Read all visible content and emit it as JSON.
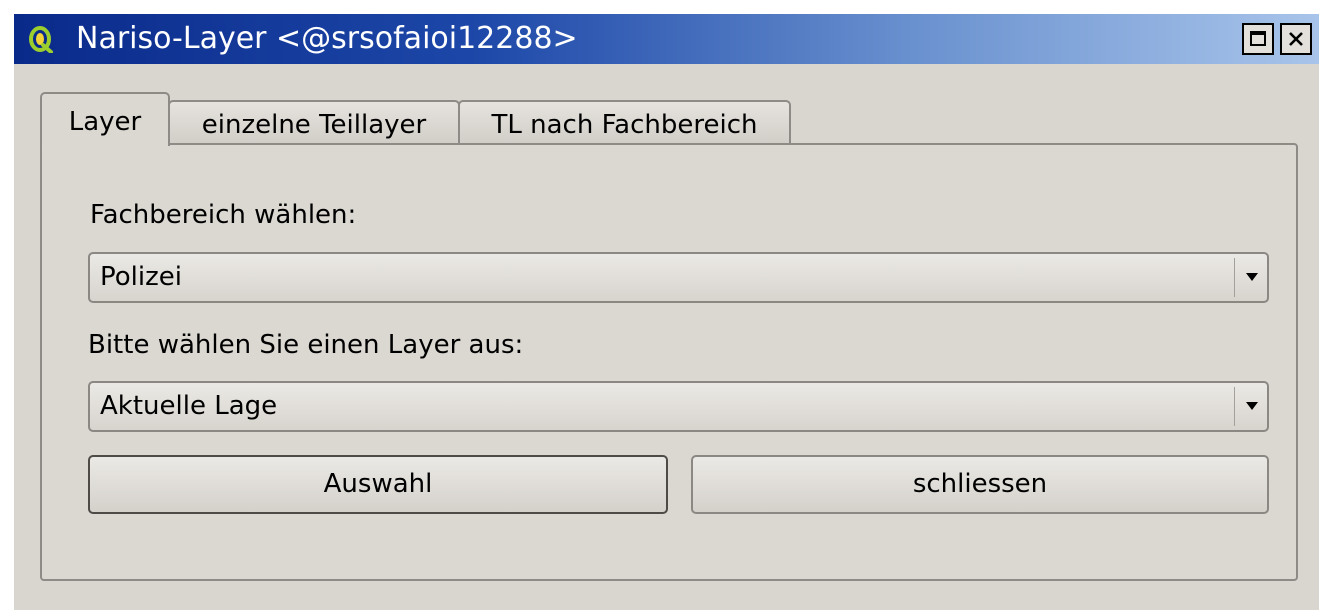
{
  "window": {
    "title": "Nariso-Layer <@srsofaioi12288>",
    "icon": "qgis-logo-icon",
    "controls": {
      "maximize_icon": "maximize-icon",
      "close_icon": "close-icon"
    }
  },
  "tabs": [
    {
      "label": "Layer",
      "active": true
    },
    {
      "label": "einzelne Teillayer",
      "active": false
    },
    {
      "label": "TL nach Fachbereich",
      "active": false
    }
  ],
  "form": {
    "fachbereich_label": "Fachbereich wählen:",
    "fachbereich_value": "Polizei",
    "layer_label": "Bitte wählen Sie einen Layer aus:",
    "layer_value": "Aktuelle Lage"
  },
  "buttons": {
    "select_label": "Auswahl",
    "close_label": "schliessen"
  },
  "colors": {
    "titlebar_start": "#0a2a8a",
    "titlebar_end": "#a8c4ea",
    "window_bg": "#d9d6d0"
  }
}
